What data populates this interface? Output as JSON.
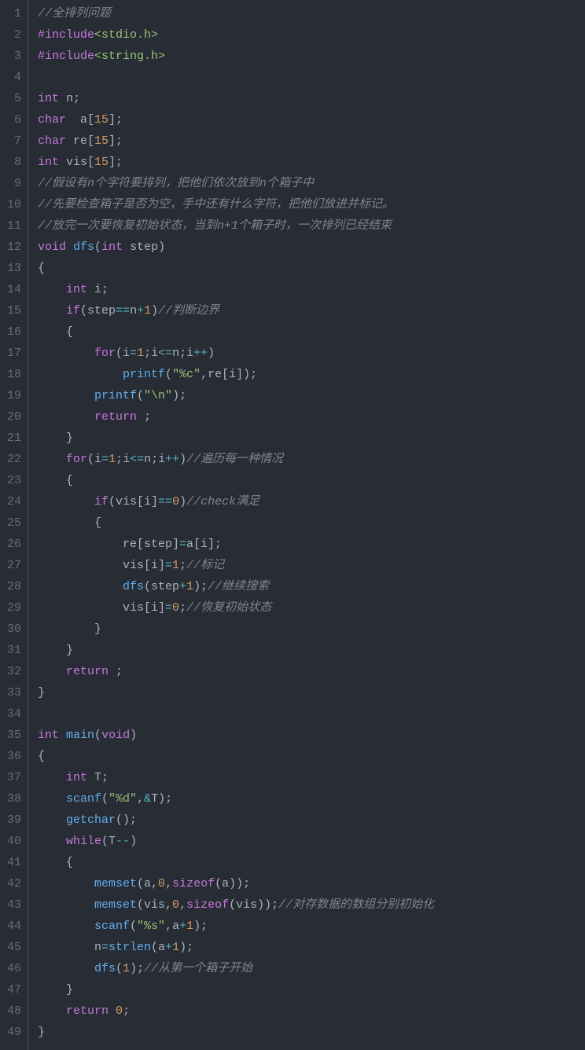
{
  "lines": [
    {
      "num": "1",
      "tokens": [
        {
          "c": "cm",
          "t": "//全排列问题"
        }
      ]
    },
    {
      "num": "2",
      "tokens": [
        {
          "c": "mc",
          "t": "#include"
        },
        {
          "c": "st",
          "t": "<stdio.h>"
        }
      ]
    },
    {
      "num": "3",
      "tokens": [
        {
          "c": "mc",
          "t": "#include"
        },
        {
          "c": "st",
          "t": "<string.h>"
        }
      ]
    },
    {
      "num": "4",
      "tokens": []
    },
    {
      "num": "5",
      "tokens": [
        {
          "c": "ty",
          "t": "int"
        },
        {
          "c": "id",
          "t": " n;"
        }
      ]
    },
    {
      "num": "6",
      "tokens": [
        {
          "c": "ty",
          "t": "char"
        },
        {
          "c": "id",
          "t": "  a["
        },
        {
          "c": "nu",
          "t": "15"
        },
        {
          "c": "id",
          "t": "];"
        }
      ]
    },
    {
      "num": "7",
      "tokens": [
        {
          "c": "ty",
          "t": "char"
        },
        {
          "c": "id",
          "t": " re["
        },
        {
          "c": "nu",
          "t": "15"
        },
        {
          "c": "id",
          "t": "];"
        }
      ]
    },
    {
      "num": "8",
      "tokens": [
        {
          "c": "ty",
          "t": "int"
        },
        {
          "c": "id",
          "t": " vis["
        },
        {
          "c": "nu",
          "t": "15"
        },
        {
          "c": "id",
          "t": "];"
        }
      ]
    },
    {
      "num": "9",
      "tokens": [
        {
          "c": "cm",
          "t": "//假设有n个字符要排列，把他们依次放到n个箱子中"
        }
      ]
    },
    {
      "num": "10",
      "tokens": [
        {
          "c": "cm",
          "t": "//先要检查箱子是否为空，手中还有什么字符，把他们放进并标记。"
        }
      ]
    },
    {
      "num": "11",
      "tokens": [
        {
          "c": "cm",
          "t": "//放完一次要恢复初始状态，当到n+1个箱子时，一次排列已经结束"
        }
      ]
    },
    {
      "num": "12",
      "tokens": [
        {
          "c": "ty",
          "t": "void"
        },
        {
          "c": "id",
          "t": " "
        },
        {
          "c": "fn",
          "t": "dfs"
        },
        {
          "c": "id",
          "t": "("
        },
        {
          "c": "ty",
          "t": "int"
        },
        {
          "c": "id",
          "t": " step)"
        }
      ]
    },
    {
      "num": "13",
      "tokens": [
        {
          "c": "id",
          "t": "{"
        }
      ]
    },
    {
      "num": "14",
      "tokens": [
        {
          "c": "id",
          "t": "    "
        },
        {
          "c": "ty",
          "t": "int"
        },
        {
          "c": "id",
          "t": " i;"
        }
      ]
    },
    {
      "num": "15",
      "tokens": [
        {
          "c": "id",
          "t": "    "
        },
        {
          "c": "mc",
          "t": "if"
        },
        {
          "c": "id",
          "t": "(step"
        },
        {
          "c": "op",
          "t": "=="
        },
        {
          "c": "id",
          "t": "n"
        },
        {
          "c": "op",
          "t": "+"
        },
        {
          "c": "nu",
          "t": "1"
        },
        {
          "c": "id",
          "t": ")"
        },
        {
          "c": "cm",
          "t": "//判断边界"
        }
      ]
    },
    {
      "num": "16",
      "tokens": [
        {
          "c": "id",
          "t": "    {"
        }
      ]
    },
    {
      "num": "17",
      "tokens": [
        {
          "c": "id",
          "t": "        "
        },
        {
          "c": "mc",
          "t": "for"
        },
        {
          "c": "id",
          "t": "(i"
        },
        {
          "c": "op",
          "t": "="
        },
        {
          "c": "nu",
          "t": "1"
        },
        {
          "c": "id",
          "t": ";i"
        },
        {
          "c": "op",
          "t": "<="
        },
        {
          "c": "id",
          "t": "n;i"
        },
        {
          "c": "op",
          "t": "++"
        },
        {
          "c": "id",
          "t": ")"
        }
      ]
    },
    {
      "num": "18",
      "tokens": [
        {
          "c": "id",
          "t": "            "
        },
        {
          "c": "fn",
          "t": "printf"
        },
        {
          "c": "id",
          "t": "("
        },
        {
          "c": "st",
          "t": "\"%c\""
        },
        {
          "c": "id",
          "t": ",re[i]);"
        }
      ]
    },
    {
      "num": "19",
      "tokens": [
        {
          "c": "id",
          "t": "        "
        },
        {
          "c": "fn",
          "t": "printf"
        },
        {
          "c": "id",
          "t": "("
        },
        {
          "c": "st",
          "t": "\"\\n\""
        },
        {
          "c": "id",
          "t": ");"
        }
      ]
    },
    {
      "num": "20",
      "tokens": [
        {
          "c": "id",
          "t": "        "
        },
        {
          "c": "mc",
          "t": "return"
        },
        {
          "c": "id",
          "t": " ;"
        }
      ]
    },
    {
      "num": "21",
      "tokens": [
        {
          "c": "id",
          "t": "    }"
        }
      ]
    },
    {
      "num": "22",
      "tokens": [
        {
          "c": "id",
          "t": "    "
        },
        {
          "c": "mc",
          "t": "for"
        },
        {
          "c": "id",
          "t": "(i"
        },
        {
          "c": "op",
          "t": "="
        },
        {
          "c": "nu",
          "t": "1"
        },
        {
          "c": "id",
          "t": ";i"
        },
        {
          "c": "op",
          "t": "<="
        },
        {
          "c": "id",
          "t": "n;i"
        },
        {
          "c": "op",
          "t": "++"
        },
        {
          "c": "id",
          "t": ")"
        },
        {
          "c": "cm",
          "t": "//遍历每一种情况"
        }
      ]
    },
    {
      "num": "23",
      "tokens": [
        {
          "c": "id",
          "t": "    {"
        }
      ]
    },
    {
      "num": "24",
      "tokens": [
        {
          "c": "id",
          "t": "        "
        },
        {
          "c": "mc",
          "t": "if"
        },
        {
          "c": "id",
          "t": "(vis[i]"
        },
        {
          "c": "op",
          "t": "=="
        },
        {
          "c": "nu",
          "t": "0"
        },
        {
          "c": "id",
          "t": ")"
        },
        {
          "c": "cm",
          "t": "//check满足"
        }
      ]
    },
    {
      "num": "25",
      "tokens": [
        {
          "c": "id",
          "t": "        {"
        }
      ]
    },
    {
      "num": "26",
      "tokens": [
        {
          "c": "id",
          "t": "            re[step]"
        },
        {
          "c": "op",
          "t": "="
        },
        {
          "c": "id",
          "t": "a[i];"
        }
      ]
    },
    {
      "num": "27",
      "tokens": [
        {
          "c": "id",
          "t": "            vis[i]"
        },
        {
          "c": "op",
          "t": "="
        },
        {
          "c": "nu",
          "t": "1"
        },
        {
          "c": "id",
          "t": ";"
        },
        {
          "c": "cm",
          "t": "//标记"
        }
      ]
    },
    {
      "num": "28",
      "tokens": [
        {
          "c": "id",
          "t": "            "
        },
        {
          "c": "fn",
          "t": "dfs"
        },
        {
          "c": "id",
          "t": "(step"
        },
        {
          "c": "op",
          "t": "+"
        },
        {
          "c": "nu",
          "t": "1"
        },
        {
          "c": "id",
          "t": ");"
        },
        {
          "c": "cm",
          "t": "//继续搜索"
        }
      ]
    },
    {
      "num": "29",
      "tokens": [
        {
          "c": "id",
          "t": "            vis[i]"
        },
        {
          "c": "op",
          "t": "="
        },
        {
          "c": "nu",
          "t": "0"
        },
        {
          "c": "id",
          "t": ";"
        },
        {
          "c": "cm",
          "t": "//恢复初始状态"
        }
      ]
    },
    {
      "num": "30",
      "tokens": [
        {
          "c": "id",
          "t": "        }"
        }
      ]
    },
    {
      "num": "31",
      "tokens": [
        {
          "c": "id",
          "t": "    }"
        }
      ]
    },
    {
      "num": "32",
      "tokens": [
        {
          "c": "id",
          "t": "    "
        },
        {
          "c": "mc",
          "t": "return"
        },
        {
          "c": "id",
          "t": " ;"
        }
      ]
    },
    {
      "num": "33",
      "tokens": [
        {
          "c": "id",
          "t": "}"
        }
      ]
    },
    {
      "num": "34",
      "tokens": []
    },
    {
      "num": "35",
      "tokens": [
        {
          "c": "ty",
          "t": "int"
        },
        {
          "c": "id",
          "t": " "
        },
        {
          "c": "fn",
          "t": "main"
        },
        {
          "c": "id",
          "t": "("
        },
        {
          "c": "ty",
          "t": "void"
        },
        {
          "c": "id",
          "t": ")"
        }
      ]
    },
    {
      "num": "36",
      "tokens": [
        {
          "c": "id",
          "t": "{"
        }
      ]
    },
    {
      "num": "37",
      "tokens": [
        {
          "c": "id",
          "t": "    "
        },
        {
          "c": "ty",
          "t": "int"
        },
        {
          "c": "id",
          "t": " T;"
        }
      ]
    },
    {
      "num": "38",
      "tokens": [
        {
          "c": "id",
          "t": "    "
        },
        {
          "c": "fn",
          "t": "scanf"
        },
        {
          "c": "id",
          "t": "("
        },
        {
          "c": "st",
          "t": "\"%d\""
        },
        {
          "c": "id",
          "t": ","
        },
        {
          "c": "op",
          "t": "&"
        },
        {
          "c": "id",
          "t": "T);"
        }
      ]
    },
    {
      "num": "39",
      "tokens": [
        {
          "c": "id",
          "t": "    "
        },
        {
          "c": "fn",
          "t": "getchar"
        },
        {
          "c": "id",
          "t": "();"
        }
      ]
    },
    {
      "num": "40",
      "tokens": [
        {
          "c": "id",
          "t": "    "
        },
        {
          "c": "mc",
          "t": "while"
        },
        {
          "c": "id",
          "t": "(T"
        },
        {
          "c": "op",
          "t": "--"
        },
        {
          "c": "id",
          "t": ")"
        }
      ]
    },
    {
      "num": "41",
      "tokens": [
        {
          "c": "id",
          "t": "    {"
        }
      ]
    },
    {
      "num": "42",
      "tokens": [
        {
          "c": "id",
          "t": "        "
        },
        {
          "c": "fn",
          "t": "memset"
        },
        {
          "c": "id",
          "t": "(a,"
        },
        {
          "c": "nu",
          "t": "0"
        },
        {
          "c": "id",
          "t": ","
        },
        {
          "c": "mc",
          "t": "sizeof"
        },
        {
          "c": "id",
          "t": "(a));"
        }
      ]
    },
    {
      "num": "43",
      "tokens": [
        {
          "c": "id",
          "t": "        "
        },
        {
          "c": "fn",
          "t": "memset"
        },
        {
          "c": "id",
          "t": "(vis,"
        },
        {
          "c": "nu",
          "t": "0"
        },
        {
          "c": "id",
          "t": ","
        },
        {
          "c": "mc",
          "t": "sizeof"
        },
        {
          "c": "id",
          "t": "(vis));"
        },
        {
          "c": "cm",
          "t": "//对存数据的数组分别初始化"
        }
      ]
    },
    {
      "num": "44",
      "tokens": [
        {
          "c": "id",
          "t": "        "
        },
        {
          "c": "fn",
          "t": "scanf"
        },
        {
          "c": "id",
          "t": "("
        },
        {
          "c": "st",
          "t": "\"%s\""
        },
        {
          "c": "id",
          "t": ",a"
        },
        {
          "c": "op",
          "t": "+"
        },
        {
          "c": "nu",
          "t": "1"
        },
        {
          "c": "id",
          "t": ");"
        }
      ]
    },
    {
      "num": "45",
      "tokens": [
        {
          "c": "id",
          "t": "        n"
        },
        {
          "c": "op",
          "t": "="
        },
        {
          "c": "fn",
          "t": "strlen"
        },
        {
          "c": "id",
          "t": "(a"
        },
        {
          "c": "op",
          "t": "+"
        },
        {
          "c": "nu",
          "t": "1"
        },
        {
          "c": "id",
          "t": ");"
        }
      ]
    },
    {
      "num": "46",
      "tokens": [
        {
          "c": "id",
          "t": "        "
        },
        {
          "c": "fn",
          "t": "dfs"
        },
        {
          "c": "id",
          "t": "("
        },
        {
          "c": "nu",
          "t": "1"
        },
        {
          "c": "id",
          "t": ");"
        },
        {
          "c": "cm",
          "t": "//从第一个箱子开始"
        }
      ]
    },
    {
      "num": "47",
      "tokens": [
        {
          "c": "id",
          "t": "    }"
        }
      ]
    },
    {
      "num": "48",
      "tokens": [
        {
          "c": "id",
          "t": "    "
        },
        {
          "c": "mc",
          "t": "return"
        },
        {
          "c": "id",
          "t": " "
        },
        {
          "c": "nu",
          "t": "0"
        },
        {
          "c": "id",
          "t": ";"
        }
      ]
    },
    {
      "num": "49",
      "tokens": [
        {
          "c": "id",
          "t": "}"
        }
      ]
    }
  ]
}
